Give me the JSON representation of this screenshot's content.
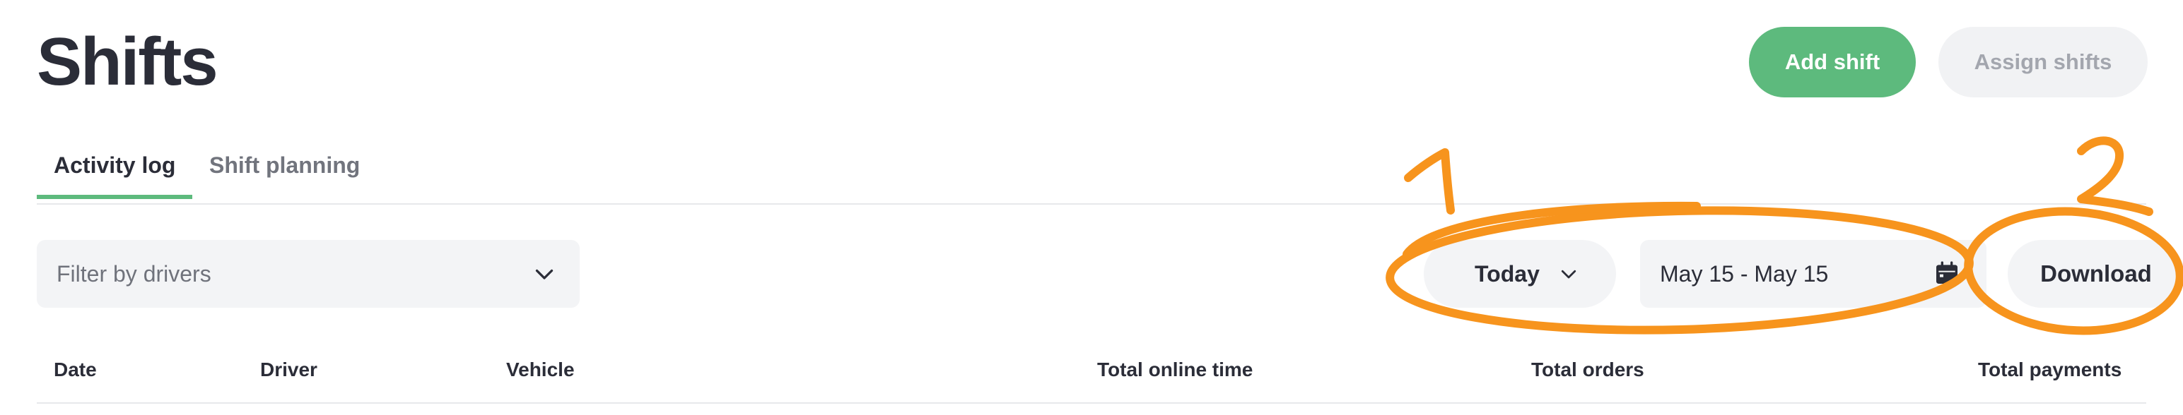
{
  "header": {
    "title": "Shifts",
    "add_shift_label": "Add shift",
    "assign_shifts_label": "Assign shifts"
  },
  "tabs": [
    {
      "label": "Activity log",
      "active": true
    },
    {
      "label": "Shift planning",
      "active": false
    }
  ],
  "toolbar": {
    "filter_placeholder": "Filter by drivers",
    "period_label": "Today",
    "date_range": "May 15 - May 15",
    "download_label": "Download"
  },
  "table": {
    "columns": [
      "Date",
      "Driver",
      "Vehicle",
      "Total online time",
      "Total orders",
      "Total payments"
    ]
  },
  "annotations": {
    "marker_1": "1",
    "marker_2": "2",
    "color": "#f7941d"
  },
  "colors": {
    "accent": "#5dba7d",
    "text": "#2b2d38",
    "muted": "#71747d",
    "control_bg": "#f3f4f6"
  }
}
